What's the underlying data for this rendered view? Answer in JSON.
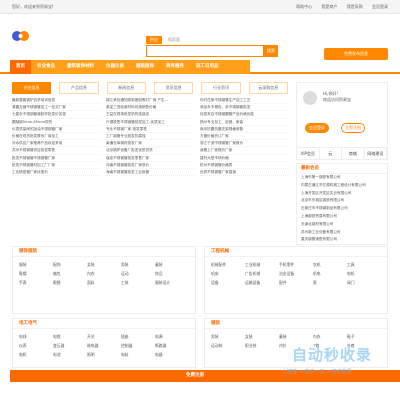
{
  "topbar": {
    "welcome": "您好，欢迎来到贸易宝!",
    "links": [
      "帮助中心",
      "我是商户",
      "我是采购",
      "会员登录"
    ]
  },
  "search": {
    "tabs": [
      "供应",
      "搜索量"
    ],
    "placeholder": "",
    "button": "搜索"
  },
  "free_publish": "免费发布信息",
  "nav": [
    "首页",
    "农业食品",
    "建筑装饰材料",
    "仪器仪表",
    "服装服饰",
    "商务服务",
    "轻工日用品"
  ],
  "content_tabs": [
    "供应信息",
    "产品信息",
    "新闻信息",
    "资讯信息",
    "行业资讯",
    "云采购信息"
  ],
  "news": [
    "最新整套锅炉自学培训信息",
    "锦江承包通知现制度制等灯厂商 产生...",
    "你们在家不锈钢管生产加工工艺",
    "清晨无缝不锈钢管加工一站式厂家",
    "莱芜三茂经营材料优惠销售价格",
    "商品永不褪色，永不锈钢管批发",
    "七星永不锈钢管道制作批发价实惠",
    "王益在现场批发机构连锁店",
    "信息来自不锈钢圆管产品价格优惠",
    "圆轴钢5mm-65mm现货",
    "兴源铁售不锈钢管批发加工-优质加工",
    "扬州专业加工、定做、家装",
    "仪表质量阀的加油不锈钢管厂家",
    "专业不锈钢厂家-批发零售",
    "南京抗震抗震支架规格参数",
    "价格在现货批发联系厂商加工",
    "工厂钢管专业批发抗腐蚀",
    "方管价格热订厂家",
    "冷水供应厂家推荐产品欢迎来电",
    "南通仓库钢材批发厂家",
    "浙江宁波不锈钢管厂家报价",
    "苏州不锈钢管供应批发零售",
    "北京锅炉设备厂批发优质供货",
    "我要上厂家报价厂家",
    "批发不锈钢管不锈钢管厂家",
    "保定不锈钢管批发零售厂家",
    "建材大型市场价格",
    "批发不锈钢管材加工厂厂家",
    "河南不锈钢管批发厂家低价",
    "杭州不锈钢管价格表",
    "工业精密管厂家优惠价",
    "海南不锈钢管批发工业用管",
    "优质不锈钢管厂家直销"
  ],
  "user": {
    "hi": "Hi,你好!",
    "welcome": "欢迎访问贸易宝",
    "login": "会员登录",
    "register": "立即注册",
    "links": [
      "VIP会员",
      "云",
      "商铺",
      "网络建设"
    ]
  },
  "newest": {
    "title": "最新会员",
    "items": [
      "上海市第一钢铁有限公司",
      "内蒙古通辽市亿源机械工程设计有限公司",
      "上海开发区开发区实业有限公司",
      "北京市东城区钢铁有限公司",
      "石家庄市不锈钢制品有限公司",
      "上海钢铁贸易有限公司",
      "天津北钢材有限公司",
      "苏州新工业设备有限公司",
      "重庆钢管销售有限公司"
    ]
  },
  "panels": [
    {
      "title": "服饰服装",
      "items": [
        "服装",
        "配饰",
        "女装",
        "男装",
        "童装",
        "鞋帽",
        "箱包",
        "内衣",
        "运动",
        "饰品",
        "手表",
        "眼镜",
        "面料",
        "工装",
        "服装设计"
      ]
    },
    {
      "title": "工程机械",
      "items": [
        "机械配件",
        "工业机械",
        "手机零件",
        "农机",
        "工具",
        "机床",
        "广告机械",
        "冶金设备",
        "机电",
        "电机",
        "设备",
        "运输设备",
        "配件",
        "泵",
        "阀门"
      ]
    },
    {
      "title": "电工电气",
      "items": [
        "电线",
        "电缆",
        "开关",
        "插座",
        "电源",
        "仪表",
        "变压器",
        "继电器",
        "控制器",
        "断路器",
        "电机",
        "电池",
        "照明",
        "电料",
        "电器"
      ]
    },
    {
      "title": "服装",
      "items": [
        "男装",
        "女装",
        "童装",
        "内衣",
        "鞋子",
        "运动装",
        "职业装",
        "衬衫",
        "T恤",
        "外套"
      ]
    }
  ],
  "banner": "免费注册",
  "watermark": {
    "title": "自动秒收录",
    "subtitle": "上链接 → 来访一次 → 自动收录"
  }
}
